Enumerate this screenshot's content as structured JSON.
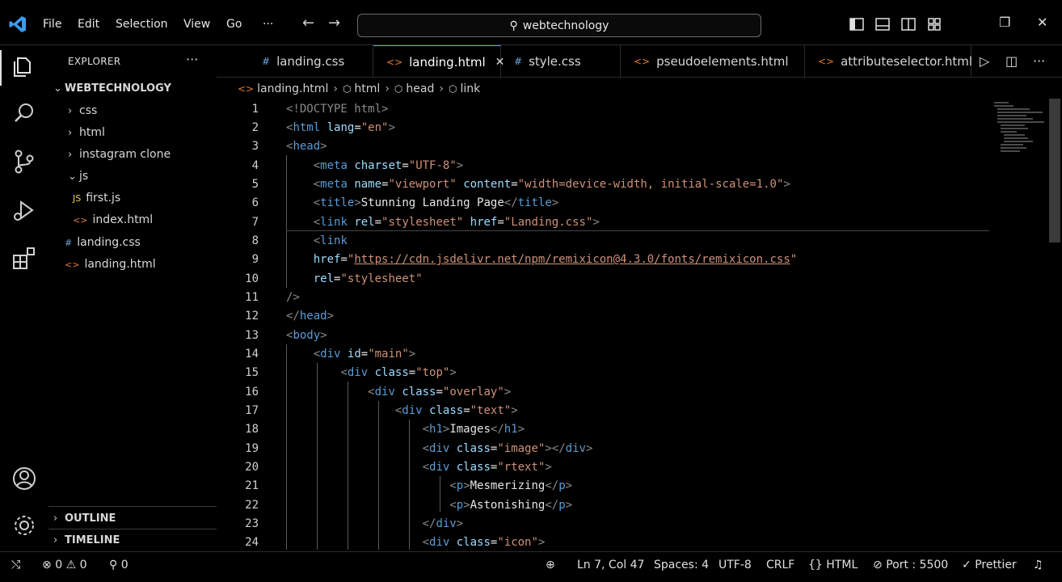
{
  "titlebar": {
    "menu": [
      "File",
      "Edit",
      "Selection",
      "View",
      "Go",
      "···"
    ],
    "search_text": "webtechnology"
  },
  "explorer": {
    "title": "EXPLORER",
    "more": "···",
    "workspace": "WEBTECHNOLOGY",
    "items": [
      {
        "label": "css",
        "type": "folder"
      },
      {
        "label": "html",
        "type": "folder"
      },
      {
        "label": "instagram clone",
        "type": "folder"
      },
      {
        "label": "js",
        "type": "folder-open"
      },
      {
        "label": "first.js",
        "type": "js"
      },
      {
        "label": "index.html",
        "type": "html"
      },
      {
        "label": "landing.css",
        "type": "css"
      },
      {
        "label": "landing.html",
        "type": "html"
      }
    ],
    "outline": "OUTLINE",
    "timeline": "TIMELINE"
  },
  "tabs": [
    {
      "label": "landing.css",
      "icon": "#",
      "type": "css"
    },
    {
      "label": "landing.html",
      "icon": "<>",
      "type": "html",
      "active": true
    },
    {
      "label": "style.css",
      "icon": "#",
      "type": "css"
    },
    {
      "label": "pseudoelements.html",
      "icon": "<>",
      "type": "html"
    },
    {
      "label": "attributeselector.html",
      "icon": "<>",
      "type": "html"
    }
  ],
  "breadcrumb": [
    "landing.html",
    "html",
    "head",
    "link"
  ],
  "editor": {
    "line_numbers": [
      "1",
      "2",
      "3",
      "4",
      "5",
      "6",
      "7",
      "8",
      "9",
      "10",
      "11",
      "12",
      "13",
      "14",
      "15",
      "16",
      "17",
      "18",
      "19",
      "20",
      "21",
      "22",
      "23",
      "24"
    ],
    "s": {
      "doctype": "<!DOCTYPE html>",
      "html_lang": "\"en\"",
      "charset_val": "\"UTF-8\"",
      "viewport_name": "\"viewport\"",
      "viewport_content": "\"width=device-width, initial-scale=1.0\"",
      "title_text": "Stunning Landing Page",
      "rel_stylesheet": "\"stylesheet\"",
      "href_landing": "\"Landing.css\"",
      "remix_url": "https://cdn.jsdelivr.net/npm/remixicon@4.3.0/fonts/remixicon.css",
      "main": "\"main\"",
      "top": "\"top\"",
      "overlay": "\"overlay\"",
      "text": "\"text\"",
      "h1_text": "Images",
      "image": "\"image\"",
      "rtext": "\"rtext\"",
      "p1": "Mesmerizing",
      "p2": "Astonishing",
      "icon": "\"icon\""
    }
  },
  "status": {
    "errors": "0",
    "warnings": "0",
    "ports": "0",
    "position": "Ln 7, Col 47",
    "spaces": "Spaces: 4",
    "encoding": "UTF-8",
    "eol": "CRLF",
    "language": "HTML",
    "port": "Port : 5500",
    "prettier": "Prettier"
  }
}
